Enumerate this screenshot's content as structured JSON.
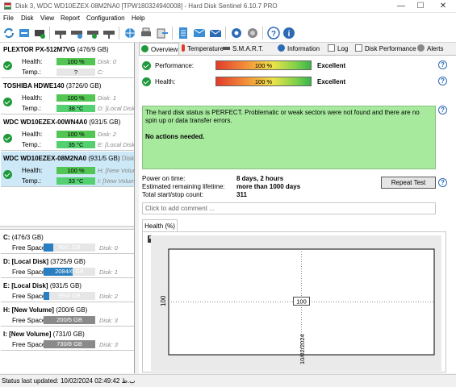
{
  "window": {
    "title": "Disk 3, WDC WD10EZEX-08M2NA0 [TPW180324940008]  -  Hard Disk Sentinel 6.10.7 PRO",
    "minimize": "—",
    "maximize": "☐",
    "close": "✕"
  },
  "menu": {
    "file": "File",
    "disk": "Disk",
    "view": "View",
    "report": "Report",
    "configuration": "Configuration",
    "help": "Help"
  },
  "disks": [
    {
      "name": "PLEXTOR PX-512M7VG",
      "size": "(476/9 GB)",
      "health_label": "Health:",
      "health": "100 %",
      "health_right": "Disk: 0",
      "temp_label": "Temp.:",
      "temp": "?",
      "temp_right": "C:"
    },
    {
      "name": "TOSHIBA HDWE140",
      "size": "(3726/0 GB)",
      "health_label": "Health:",
      "health": "100 %",
      "health_right": "Disk: 1",
      "temp_label": "Temp.:",
      "temp": "38 °C",
      "temp_right": "D: [Local Disk]"
    },
    {
      "name": "WDC WD10EZEX-00WN4A0",
      "size": "(931/5 GB)",
      "health_label": "Health:",
      "health": "100 %",
      "health_right": "Disk: 2",
      "temp_label": "Temp.:",
      "temp": "35 °C",
      "temp_right": "E: [Local Disk]"
    },
    {
      "name": "WDC WD10EZEX-08M2NA0",
      "size": "(931/5 GB)",
      "health_label": "Health:",
      "health": "100 %",
      "health_right": "H: [New Volume]",
      "temp_label": "Temp.:",
      "temp": "33 °C",
      "temp_right": "I: [New Volume]",
      "extra": "Disk"
    }
  ],
  "volumes": [
    {
      "name": "C:",
      "size": "(476/3 GB)",
      "fs_label": "Free Space",
      "free": "90/1 GB",
      "free_pct": 0.19,
      "disk": "Disk: 0"
    },
    {
      "name": "D: [Local Disk]",
      "size": "(3725/9 GB)",
      "fs_label": "Free Space",
      "free": "2084/6 GB",
      "free_pct": 0.56,
      "disk": "Disk: 1"
    },
    {
      "name": "E: [Local Disk]",
      "size": "(931/5 GB)",
      "fs_label": "Free Space",
      "free": "99/4 GB",
      "free_pct": 0.11,
      "disk": "Disk: 2"
    },
    {
      "name": "H: [New Volume]",
      "size": "(200/6 GB)",
      "fs_label": "Free Space",
      "free": "200/5 GB",
      "free_pct": 1.0,
      "disk": "Disk: 3"
    },
    {
      "name": "I: [New Volume]",
      "size": "(731/0 GB)",
      "fs_label": "Free Space",
      "free": "730/8 GB",
      "free_pct": 1.0,
      "disk": "Disk: 3"
    }
  ],
  "tabs": [
    "Overview",
    "Temperature",
    "S.M.A.R.T.",
    "Information",
    "Log",
    "Disk Performance",
    "Alerts"
  ],
  "overview": {
    "performance_label": "Performance:",
    "performance_value": "100 %",
    "performance_status": "Excellent",
    "health_label": "Health:",
    "health_value": "100 %",
    "health_status": "Excellent",
    "status_text": "The hard disk status is PERFECT. Problematic or weak sectors were not found and there are no spin up or data transfer errors.",
    "actions_text": "No actions needed.",
    "power_on_label": "Power on time:",
    "power_on_value": "8 days, 2 hours",
    "lifetime_label": "Estimated remaining lifetime:",
    "lifetime_value": "more than 1000 days",
    "startstop_label": "Total start/stop count:",
    "startstop_value": "311",
    "repeat_test": "Repeat Test",
    "comment_placeholder": "Click to add comment ...",
    "health_tab": "Health (%)"
  },
  "chart_data": {
    "type": "line",
    "x": [
      "10/02/2024"
    ],
    "series": [
      {
        "values": [
          100
        ]
      }
    ],
    "ylabel": "100",
    "point_label": "100",
    "xlabel": "10/02/2024"
  },
  "statusbar": {
    "text": "Status last updated: 10/02/2024 02:49:42 ب.ظ"
  },
  "colors": {
    "ok": "#1f9a3a",
    "selected": "#cde8f6",
    "status_bg": "#a7ea9e",
    "volume_bar": "#2a7fc0"
  }
}
